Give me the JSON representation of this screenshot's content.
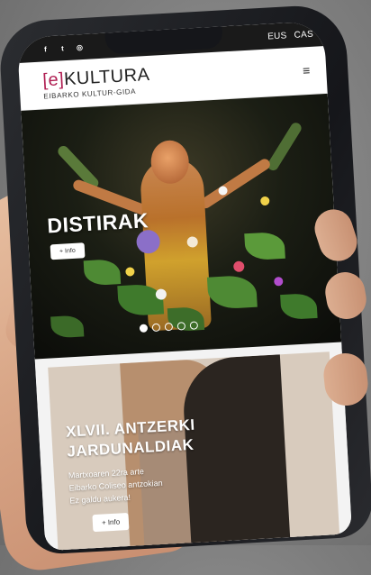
{
  "topbar": {
    "social": [
      {
        "icon": "facebook-icon",
        "glyph": "f"
      },
      {
        "icon": "twitter-icon",
        "glyph": "t"
      },
      {
        "icon": "instagram-icon",
        "glyph": "◎"
      }
    ],
    "languages": [
      "EUS",
      "CAS"
    ]
  },
  "header": {
    "logo_bracket_open": "[",
    "logo_e": "e",
    "logo_bracket_close": "]",
    "logo_word": "KULTURA",
    "logo_subtitle": "EIBARKO KULTUR-GIDA",
    "menu_icon": "hamburger-icon",
    "menu_glyph": "≡"
  },
  "hero": {
    "title": "DISTIRAK",
    "button_label": "+ Info",
    "slides": 5,
    "active_slide": 1
  },
  "event_card": {
    "title_line1": "XLVII. ANTZERKI",
    "title_line2": "JARDUNALDIAK",
    "lines": [
      "Martxoaren 22ra arte",
      "Eibarko Coliseo antzokian",
      "Ez galdu aukera!"
    ],
    "button_label": "+ Info"
  },
  "colors": {
    "brand": "#b01e52",
    "topbar": "#1a1a1a"
  }
}
